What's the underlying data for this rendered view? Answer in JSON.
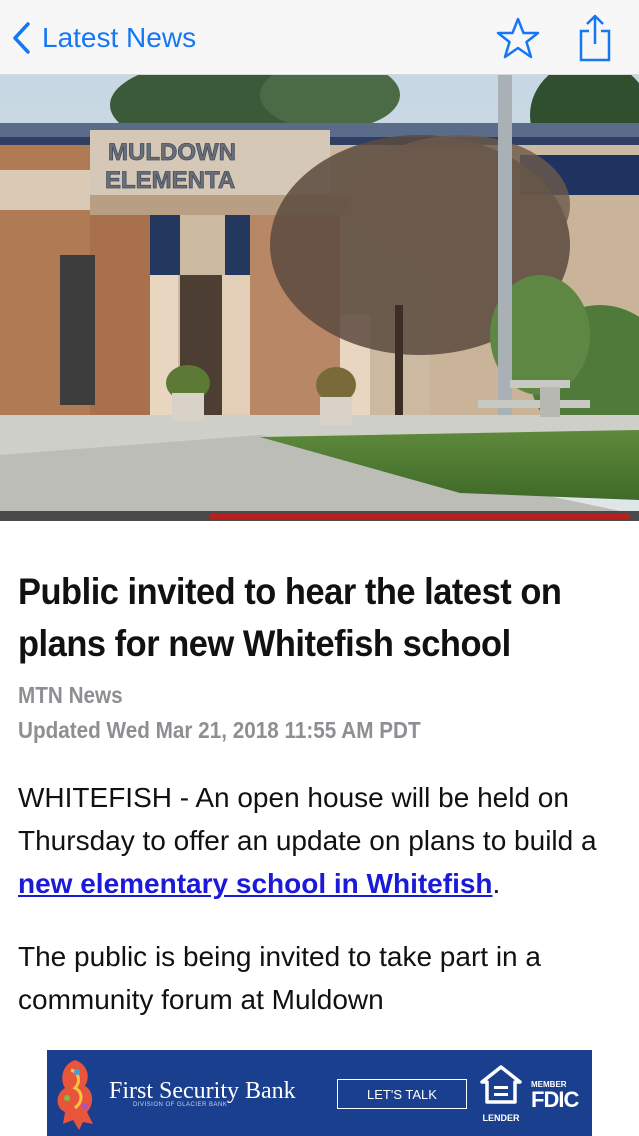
{
  "nav": {
    "back_label": "Latest News",
    "icons": [
      "chevron-left-icon",
      "star-icon",
      "share-icon"
    ],
    "accent_color": "#1677f5"
  },
  "hero": {
    "sign_line1": "MULDOWN",
    "sign_line2": "ELEMENTA"
  },
  "article": {
    "headline": "Public invited to hear the latest on plans for new Whitefish school",
    "source": "MTN News",
    "updated": "Updated Wed Mar 21, 2018 11:55 AM PDT",
    "para1_before": "WHITEFISH - An open house will be held on Thursday to offer an update on plans to build a ",
    "para1_link": "new elementary school in Whitefish",
    "para1_after": ".",
    "para2": "The public is being invited to take part in a community forum at Muldown",
    "link_color": "#1a1ad8"
  },
  "ad": {
    "name": "First Security Bank",
    "subline": "DIVISION OF GLACIER BANK",
    "cta": "LET'S TALK",
    "housing_label": "LENDER",
    "member_label": "MEMBER",
    "fdic_label": "FDIC",
    "background": "#1a3f8f"
  }
}
